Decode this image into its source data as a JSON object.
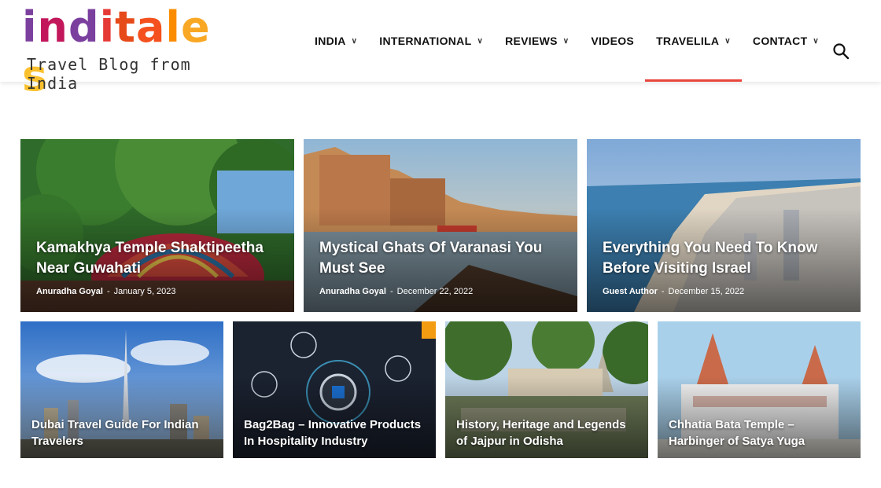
{
  "logo": {
    "word": "inditales",
    "tagline": "Travel Blog from India",
    "letter_colors": [
      "#7b3f9e",
      "#c2185b",
      "#7b3f9e",
      "#e53935",
      "#e64a19",
      "#f4511e",
      "#fb8c00",
      "#f9a825",
      "#fbc02d"
    ]
  },
  "nav": {
    "items": [
      {
        "label": "INDIA",
        "has_dropdown": true,
        "active": false
      },
      {
        "label": "INTERNATIONAL",
        "has_dropdown": true,
        "active": false
      },
      {
        "label": "REVIEWS",
        "has_dropdown": true,
        "active": false
      },
      {
        "label": "VIDEOS",
        "has_dropdown": false,
        "active": false
      },
      {
        "label": "TRAVELILA",
        "has_dropdown": true,
        "active": true
      },
      {
        "label": "CONTACT",
        "has_dropdown": true,
        "active": false
      }
    ],
    "search_icon": "search-icon",
    "active_color": "#e8453c"
  },
  "featured": [
    {
      "title": "Kamakhya Temple Shaktipeetha Near Guwahati",
      "author": "Anuradha Goyal",
      "date": "January 5, 2023"
    },
    {
      "title": "Mystical Ghats Of Varanasi You Must See",
      "author": "Anuradha Goyal",
      "date": "December 22, 2022"
    },
    {
      "title": "Everything You Need To Know Before Visiting Israel",
      "author": "Guest Author",
      "date": "December 15, 2022"
    }
  ],
  "secondary": [
    {
      "title": "Dubai Travel Guide For Indian Travelers"
    },
    {
      "title": "Bag2Bag – Innovative Products In Hospitality Industry"
    },
    {
      "title": "History, Heritage and Legends of Jajpur in Odisha"
    },
    {
      "title": "Chhatia Bata Temple – Harbinger of Satya Yuga"
    }
  ]
}
